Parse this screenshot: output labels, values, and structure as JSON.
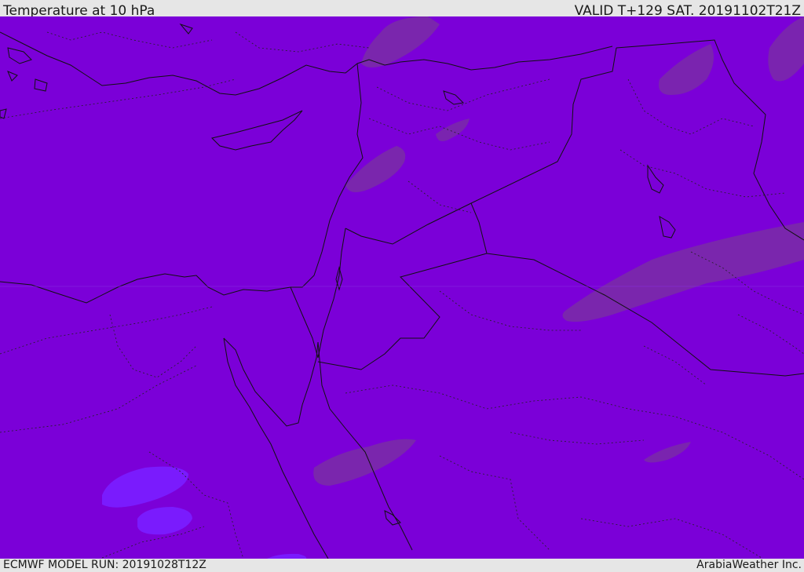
{
  "header": {
    "title": "Temperature at 10 hPa",
    "valid": "VALID T+129 SAT. 20191102T21Z"
  },
  "footer": {
    "model_run": "ECMWF MODEL RUN: 20191028T12Z",
    "brand": "ArabiaWeather Inc."
  },
  "map": {
    "background_color": "#7b00d8",
    "warm_patch_color": "#7a2aa8",
    "cool_patch_color": "#7a1cff",
    "coastline_color": "#111111",
    "border_color": "#111111"
  }
}
